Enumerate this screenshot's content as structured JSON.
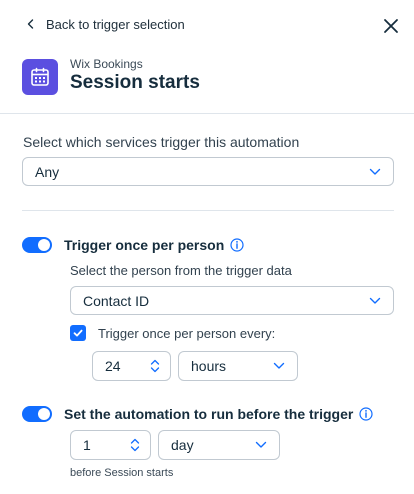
{
  "header": {
    "back_label": "Back to trigger selection",
    "app_name": "Wix Bookings",
    "trigger_title": "Session starts"
  },
  "services": {
    "label": "Select which services trigger this automation",
    "selected": "Any"
  },
  "once_per_person": {
    "enabled": true,
    "label": "Trigger once per person",
    "person_label": "Select the person from the trigger data",
    "person_selected": "Contact ID",
    "every_checked": true,
    "every_label": "Trigger once per person every:",
    "every_value": "24",
    "every_unit": "hours"
  },
  "run_before": {
    "enabled": true,
    "label": "Set the automation to run before the trigger",
    "value": "1",
    "unit": "day",
    "suffix": "before Session starts"
  },
  "colors": {
    "accent": "#116dff",
    "app_icon": "#5b4fe0"
  },
  "icons": [
    "chevron-left-icon",
    "close-icon",
    "calendar-icon",
    "chevron-down-icon",
    "info-icon",
    "checkmark-icon",
    "stepper-arrows-icon"
  ]
}
